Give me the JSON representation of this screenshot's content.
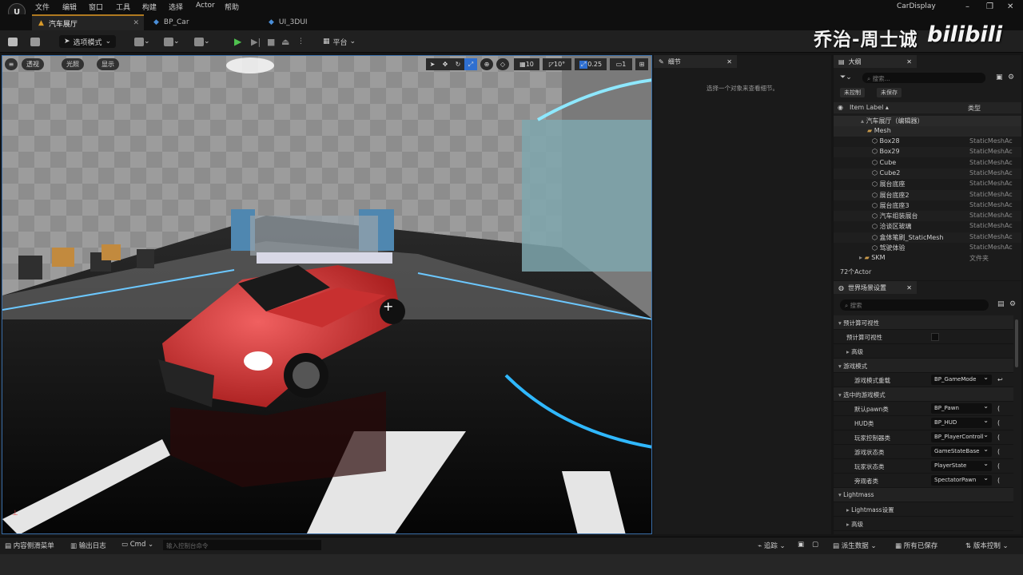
{
  "menu": {
    "items": [
      "文件",
      "编辑",
      "窗口",
      "工具",
      "构建",
      "选择",
      "Actor",
      "帮助"
    ],
    "project_name": "CarDisplay"
  },
  "tabs": [
    {
      "label": "汽车展厅"
    },
    {
      "label": "BP_Car"
    },
    {
      "label": "UI_3DUI"
    }
  ],
  "toolbar": {
    "mode_label": "选项模式",
    "platform_label": "平台"
  },
  "watermark": {
    "author": "乔治-周士诚",
    "site": "bilibili"
  },
  "viewport": {
    "left_buttons": [
      "透视",
      "光照",
      "显示"
    ],
    "right_values": [
      "10",
      "10°",
      "0.25",
      "1"
    ]
  },
  "details": {
    "title": "细节",
    "empty_hint": "选择一个对象来查看细节。"
  },
  "outliner": {
    "title": "大纲",
    "search_placeholder": "搜索...",
    "filter_buttons": [
      "未控制",
      "未保存"
    ],
    "col_label": "Item Label ▴",
    "col_type": "类型",
    "root": "汽车展厅（编辑器）",
    "folder_mesh": "Mesh",
    "items": [
      {
        "label": "Box28",
        "type": "StaticMeshAc"
      },
      {
        "label": "Box29",
        "type": "StaticMeshAc"
      },
      {
        "label": "Cube",
        "type": "StaticMeshAc"
      },
      {
        "label": "Cube2",
        "type": "StaticMeshAc"
      },
      {
        "label": "展台底座",
        "type": "StaticMeshAc"
      },
      {
        "label": "展台底座2",
        "type": "StaticMeshAc"
      },
      {
        "label": "展台底座3",
        "type": "StaticMeshAc"
      },
      {
        "label": "汽车组装展台",
        "type": "StaticMeshAc"
      },
      {
        "label": "洽谈区玻璃",
        "type": "StaticMeshAc"
      },
      {
        "label": "盒体笔刷_StaticMesh",
        "type": "StaticMeshAc"
      },
      {
        "label": "驾驶体验",
        "type": "StaticMeshAc"
      }
    ],
    "folder_skm": {
      "label": "SKM",
      "type": "文件夹"
    },
    "count": "72个Actor"
  },
  "world_settings": {
    "title": "世界场景设置",
    "search_placeholder": "搜索",
    "rows": [
      {
        "key": "预计算可视性",
        "section": true
      },
      {
        "key": "预计算可视性",
        "checkbox": true
      },
      {
        "key": "高级",
        "collapsed": true
      },
      {
        "key": "游戏模式",
        "section": true
      },
      {
        "key": "游戏模式重载",
        "value": "BP_GameMode"
      },
      {
        "key": "选中的游戏模式",
        "section": true
      },
      {
        "key": "默认pawn类",
        "value": "BP_Pawn"
      },
      {
        "key": "HUD类",
        "value": "BP_HUD"
      },
      {
        "key": "玩家控制器类",
        "value": "BP_PlayerControll"
      },
      {
        "key": "游戏状态类",
        "value": "GameStateBase"
      },
      {
        "key": "玩家状态类",
        "value": "PlayerState"
      },
      {
        "key": "旁观者类",
        "value": "SpectatorPawn"
      },
      {
        "key": "Lightmass",
        "section": true
      },
      {
        "key": "Lightmass设置",
        "collapsed": true
      },
      {
        "key": "高级",
        "collapsed": true
      }
    ]
  },
  "statusbar": {
    "content_drawer": "内容侧滑菜单",
    "output_log": "输出日志",
    "cmd": "Cmd",
    "cmd_placeholder": "输入控制台命令",
    "trace": "追踪",
    "derived_data": "派生数据",
    "all_saved": "所有已保存",
    "source_control": "版本控制"
  }
}
